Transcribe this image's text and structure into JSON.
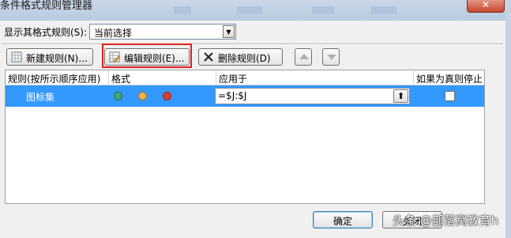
{
  "window": {
    "title": "条件格式规则管理器",
    "close_glyph": "✕"
  },
  "show_rules": {
    "label": "显示其格式规则(S):",
    "selected": "当前选择"
  },
  "toolbar": {
    "new_rule": "新建规则(N)...",
    "edit_rule": "编辑规则(E)...",
    "delete_rule": "删除规则(D)"
  },
  "table": {
    "headers": [
      "规则(按所示顺序应用)",
      "格式",
      "应用于",
      "如果为真则停止"
    ],
    "rows": [
      {
        "rule": "图标集",
        "format_icons": [
          "#3fa77a",
          "#f0b04a",
          "#e03a2e"
        ],
        "applies_to": "=$J:$J",
        "stop_if_true": false
      }
    ]
  },
  "footer": {
    "ok": "确定",
    "cancel": "关闭"
  },
  "watermark": "头条 @部落窝教育h"
}
